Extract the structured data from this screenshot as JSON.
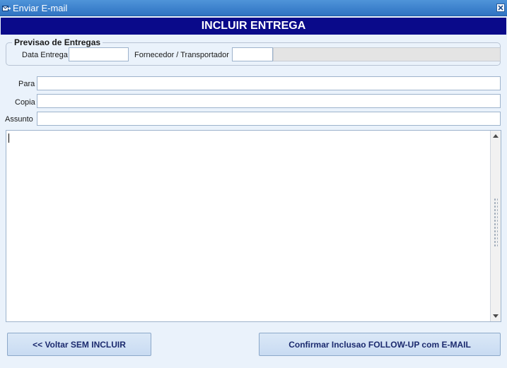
{
  "window": {
    "title": "Enviar E-mail",
    "app_icon": "email-send-icon",
    "close_icon": "close-icon"
  },
  "banner": {
    "title": "INCLUIR ENTREGA"
  },
  "previsao": {
    "legend": "Previsao de Entregas",
    "data_entrega_label": "Data Entrega",
    "data_entrega_value": "",
    "fornecedor_label": "Fornecedor / Transportador",
    "fornecedor_code": "",
    "fornecedor_name": ""
  },
  "email": {
    "para_label": "Para",
    "para_value": "",
    "copia_label": "Copia",
    "copia_value": "",
    "assunto_label": "Assunto",
    "assunto_value": "",
    "body": ""
  },
  "buttons": {
    "voltar": "<< Voltar SEM INCLUIR",
    "confirmar": "Confirmar Inclusao FOLLOW-UP com E-MAIL"
  },
  "colors": {
    "titlebar": "#3c83cf",
    "banner": "#0a0a8a",
    "background": "#eaf2fb",
    "button_text": "#1b2a6e"
  }
}
